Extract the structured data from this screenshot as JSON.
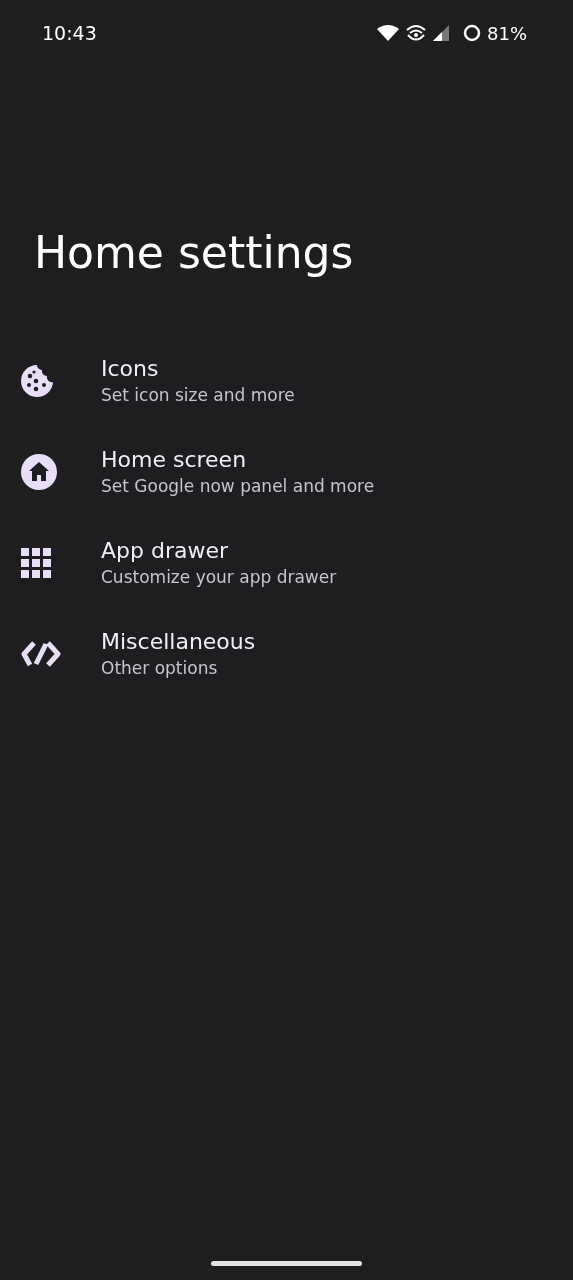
{
  "status_bar": {
    "time": "10:43",
    "battery": "81%"
  },
  "title": "Home settings",
  "items": [
    {
      "kind": "cookie",
      "title": "Icons",
      "subtitle": "Set icon size and more"
    },
    {
      "kind": "home",
      "title": "Home screen",
      "subtitle": "Set Google now panel and more"
    },
    {
      "kind": "grid",
      "title": "App drawer",
      "subtitle": "Customize your app drawer"
    },
    {
      "kind": "code",
      "title": "Miscellaneous",
      "subtitle": "Other options"
    }
  ]
}
